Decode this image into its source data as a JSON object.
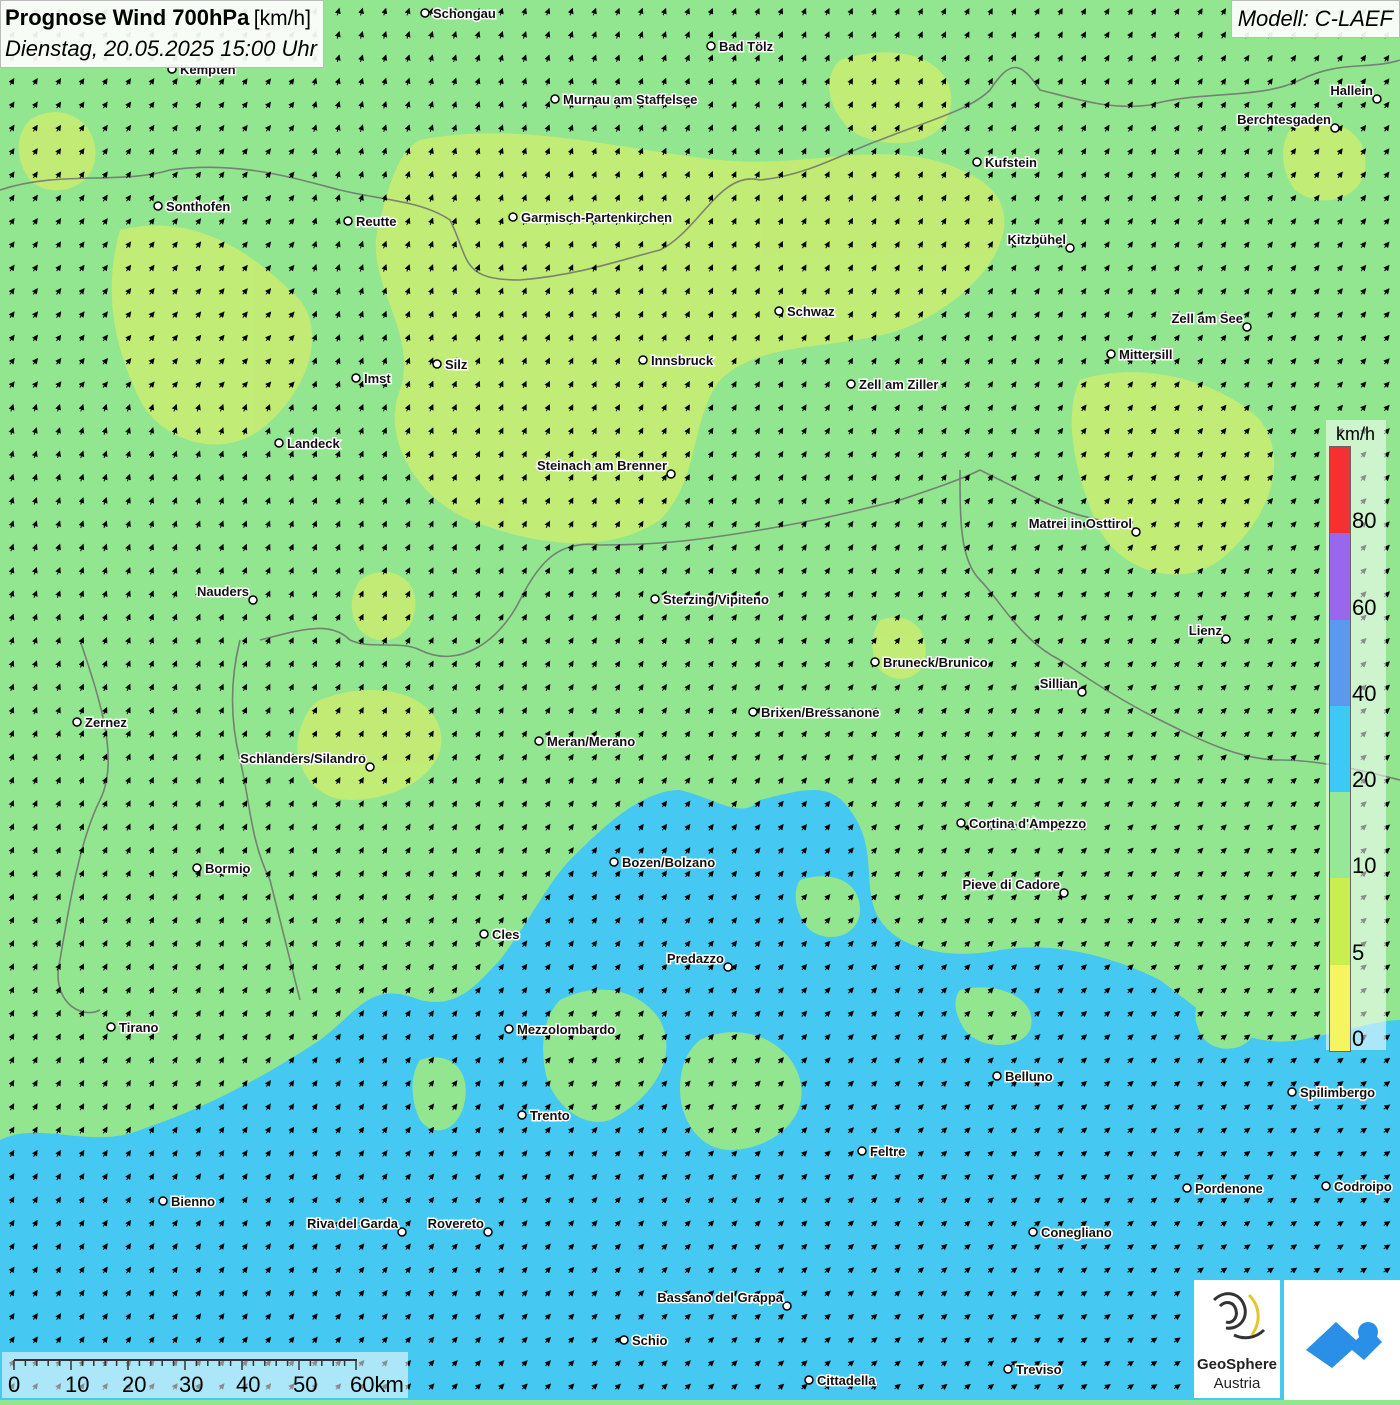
{
  "header": {
    "title": "Prognose Wind 700hPa",
    "unit": "[km/h]",
    "datetime": "Dienstag, 20.05.2025 15:00 Uhr",
    "model": "Modell: C-LAEF"
  },
  "legend": {
    "unit": "km/h",
    "bins": [
      {
        "label": "0",
        "color": "#f5f562"
      },
      {
        "label": "5",
        "color": "#c8ef4f"
      },
      {
        "label": "10",
        "color": "#94e896"
      },
      {
        "label": "20",
        "color": "#3ec8f5"
      },
      {
        "label": "40",
        "color": "#5b98f0"
      },
      {
        "label": "60",
        "color": "#9966ee"
      },
      {
        "label": "80",
        "color": "#f53030"
      }
    ]
  },
  "scale_bar": {
    "labels": [
      "0",
      "10",
      "20",
      "30",
      "40",
      "50",
      "60km"
    ]
  },
  "wind": {
    "direction": "north to north-east",
    "predominant_range": "5-20 km/h"
  },
  "cities": [
    "Schongau",
    "Bad Tölz",
    "Kempten",
    "Murnau am Staffelsee",
    "Hallein",
    "Berchtesgaden",
    "Kufstein",
    "Sonthofen",
    "Reutte",
    "Garmisch-Partenkirchen",
    "Kitzbühel",
    "Schwaz",
    "Zell am See",
    "Mittersill",
    "Imst",
    "Silz",
    "Innsbruck",
    "Zell am Ziller",
    "Landeck",
    "Steinach am Brenner",
    "Matrei in Osttirol",
    "Nauders",
    "Sterzing/Vipiteno",
    "Lienz",
    "Bruneck/Brunico",
    "Sillian",
    "Zernez",
    "Brixen/Bressanone",
    "Meran/Merano",
    "Schlanders/Silandro",
    "Cortina d'Ampezzo",
    "Bozen/Bolzano",
    "Bormio",
    "Pieve di Cadore",
    "Cles",
    "Predazzo",
    "Tirano",
    "Mezzolombardo",
    "Belluno",
    "Spilimbergo",
    "Trento",
    "Feltre",
    "Bienno",
    "Pordenone",
    "Codroipo",
    "Riva del Garda",
    "Rovereto",
    "Conegliano",
    "Bassano del Grappa",
    "Schio",
    "Treviso",
    "Cittadella"
  ],
  "logos": {
    "geosphere_line1": "GeoSphere",
    "geosphere_line2": "Austria"
  }
}
